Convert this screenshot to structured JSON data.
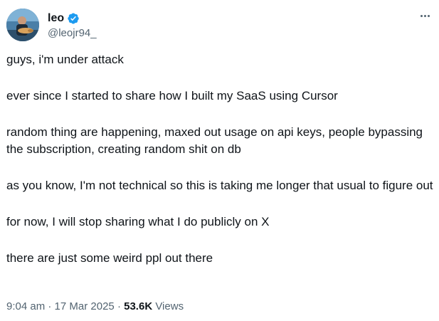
{
  "author": {
    "display_name": "leo",
    "handle": "@leojr94_",
    "verified": true
  },
  "icons": {
    "verified": "verified-badge-icon",
    "more": "more-options-icon"
  },
  "colors": {
    "verified_blue": "#1d9bf0",
    "text_primary": "#0f1419",
    "text_secondary": "#536471"
  },
  "paragraphs": [
    "guys, i'm under attack",
    "ever since I started to share how I built my SaaS using Cursor",
    "random thing are happening, maxed out usage on api keys, people bypassing the subscription, creating random shit on db",
    "as you know, I'm not technical so this is taking me longer that usual to figure out",
    "for now, I will stop sharing what I do publicly on X",
    "there are just some weird ppl out there"
  ],
  "meta": {
    "time": "9:04 am",
    "separator": "·",
    "date": "17 Mar 2025",
    "views_count": "53.6K",
    "views_label": "Views"
  }
}
